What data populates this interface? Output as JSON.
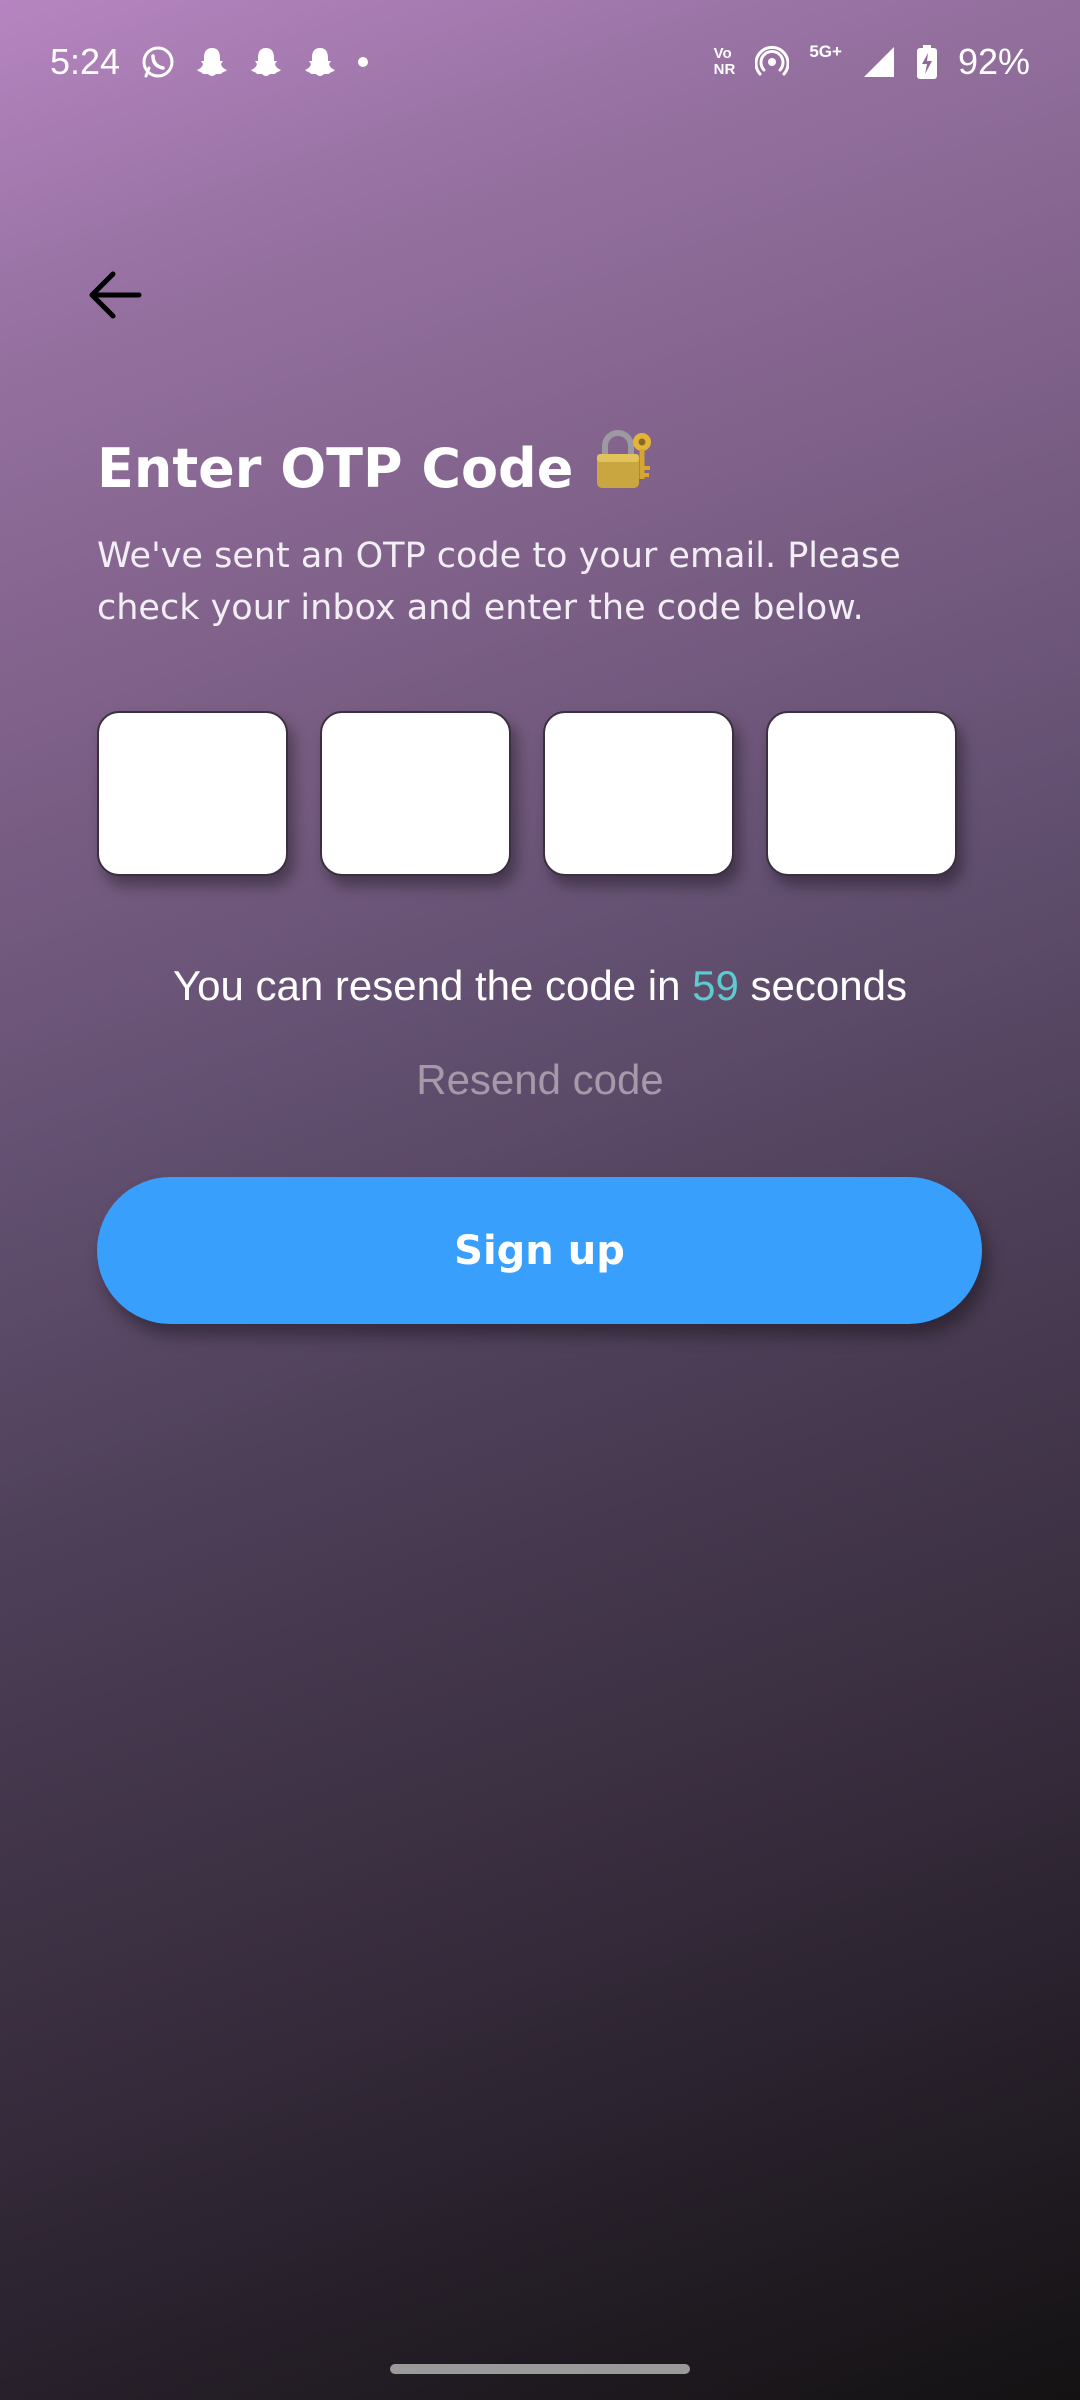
{
  "status_bar": {
    "time": "5:24",
    "notification_icons": [
      "whatsapp-icon",
      "snapchat-icon",
      "snapchat-icon",
      "snapchat-icon",
      "dot-icon"
    ],
    "volte_line1": "Vo",
    "volte_line2": "NR",
    "network_label": "5G+",
    "battery": "92%"
  },
  "header": {
    "back_icon": "arrow-left-icon"
  },
  "main": {
    "title": "Enter OTP Code",
    "title_icon": "lock-with-key-icon",
    "subtitle": "We've sent an OTP code to your email. Please check your inbox and enter the code below.",
    "otp_boxes": [
      "",
      "",
      "",
      ""
    ],
    "resend_prefix": "You can resend the code in ",
    "countdown": "59",
    "resend_suffix": " seconds",
    "resend_link": "Resend code",
    "signup_label": "Sign up"
  },
  "colors": {
    "primary_button": "#399ffd",
    "countdown": "#5ecbd0",
    "resend_disabled": "#a69aa9"
  }
}
